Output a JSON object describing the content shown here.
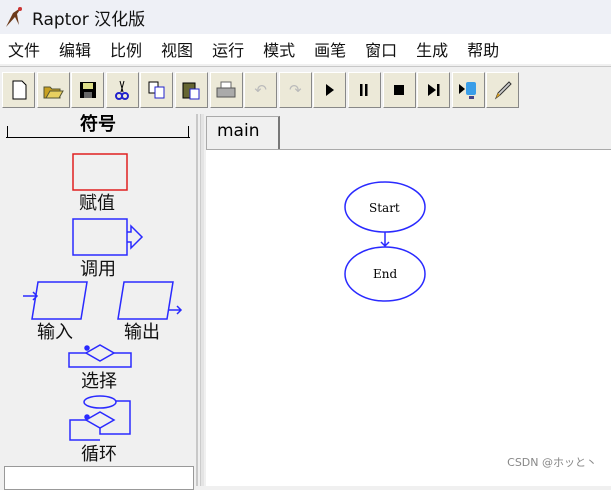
{
  "window": {
    "title": "Raptor 汉化版"
  },
  "menu": [
    "文件",
    "编辑",
    "比例",
    "视图",
    "运行",
    "模式",
    "画笔",
    "窗口",
    "生成",
    "帮助"
  ],
  "toolbar": [
    {
      "icon": "new-file-icon",
      "enabled": true
    },
    {
      "icon": "open-folder-icon",
      "enabled": true
    },
    {
      "icon": "save-icon",
      "enabled": true
    },
    {
      "icon": "cut-icon",
      "enabled": true
    },
    {
      "icon": "copy-icon",
      "enabled": true
    },
    {
      "icon": "paste-icon",
      "enabled": true
    },
    {
      "icon": "print-icon",
      "enabled": true
    },
    {
      "icon": "undo-icon",
      "enabled": false
    },
    {
      "icon": "redo-icon",
      "enabled": false
    },
    {
      "icon": "play-icon",
      "enabled": true
    },
    {
      "icon": "pause-icon",
      "enabled": true
    },
    {
      "icon": "stop-icon",
      "enabled": true
    },
    {
      "icon": "step-icon",
      "enabled": true
    },
    {
      "icon": "test-server-icon",
      "enabled": true
    },
    {
      "icon": "pen-icon",
      "enabled": true
    }
  ],
  "symbols": {
    "header": "符号",
    "assign": "赋值",
    "call": "调用",
    "input": "输入",
    "output": "输出",
    "select": "选择",
    "loop": "循环"
  },
  "tabs": [
    "main"
  ],
  "flowchart": {
    "start": "Start",
    "end": "End"
  },
  "colors": {
    "symbol_blue": "#2a2aff",
    "assign_red": "#e02020"
  },
  "watermark": "CSDN @ホッと丶"
}
